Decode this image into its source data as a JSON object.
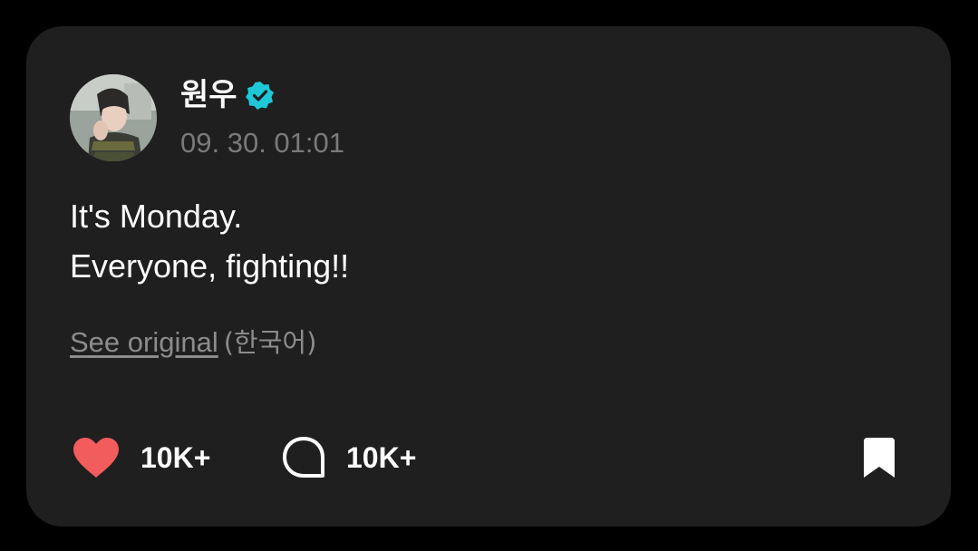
{
  "post": {
    "author": "원우",
    "verified_icon": "verified-badge-icon",
    "timestamp": "09. 30. 01:01",
    "body_line_1": "It's Monday.",
    "body_line_2": "Everyone, fighting!!",
    "see_original_label": "See original",
    "original_language": "(한국어)"
  },
  "actions": {
    "likes": "10K+",
    "comments": "10K+",
    "like_icon": "heart-icon",
    "comment_icon": "comment-bubble-icon",
    "bookmark_icon": "bookmark-icon"
  },
  "colors": {
    "background": "#000000",
    "card": "#1f1f1f",
    "verified": "#1ec8d8",
    "heart": "#f25c5c",
    "muted_text": "#7a7a7a"
  }
}
